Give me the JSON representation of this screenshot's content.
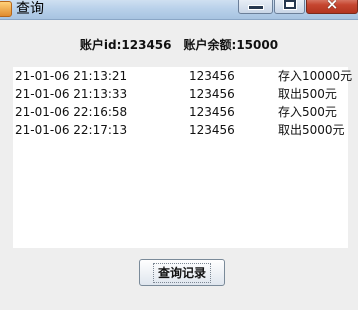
{
  "window": {
    "title": "查询",
    "icon": "java-cup-icon",
    "controls": {
      "minimize": "minimize-icon",
      "maximize": "maximize-icon",
      "close": "×"
    }
  },
  "account": {
    "id_text": "账户id:123456",
    "balance_text": "账户余额:15000"
  },
  "records": [
    {
      "time": "21-01-06 21:13:21",
      "account_id": "123456",
      "operation": "存入10000元"
    },
    {
      "time": "21-01-06 21:13:33",
      "account_id": "123456",
      "operation": "取出500元"
    },
    {
      "time": "21-01-06 22:16:58",
      "account_id": "123456",
      "operation": "存入500元"
    },
    {
      "time": "21-01-06 22:17:13",
      "account_id": "123456",
      "operation": "取出5000元"
    }
  ],
  "query_button": {
    "label": "查询记录"
  }
}
